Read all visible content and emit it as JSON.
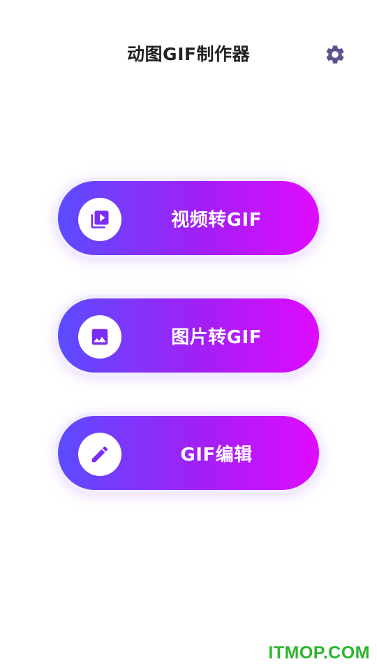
{
  "header": {
    "title": "动图GIF制作器",
    "settings_icon": "gear-icon"
  },
  "actions": [
    {
      "label": "视频转GIF",
      "icon": "video-library-icon"
    },
    {
      "label": "图片转GIF",
      "icon": "image-icon"
    },
    {
      "label": "GIF编辑",
      "icon": "pencil-icon"
    }
  ],
  "watermark": "ITMOP.COM",
  "colors": {
    "gradient_start": "#5b4cff",
    "gradient_end": "#e00bff",
    "icon_purple": "#7a2cf5",
    "settings_gray": "#5a5490",
    "title_text": "#222222",
    "watermark_green": "#2db52d"
  }
}
